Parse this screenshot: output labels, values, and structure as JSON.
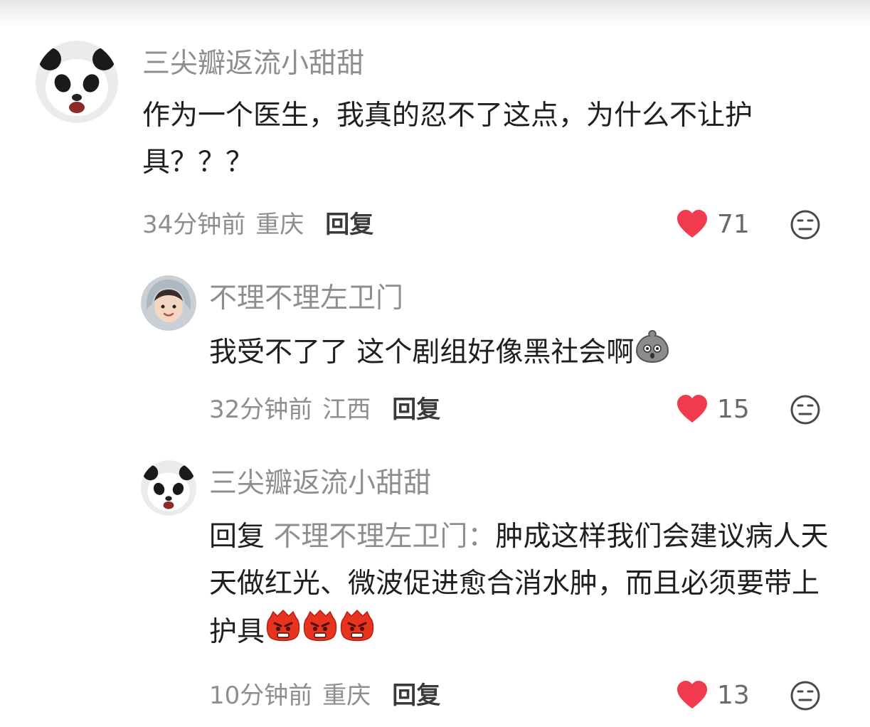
{
  "comments": [
    {
      "username": "三尖瓣返流小甜甜",
      "text": "作为一个医生，我真的忍不了这点，为什么不让护具？？？",
      "time": "34分钟前",
      "location": "重庆",
      "reply_label": "回复",
      "likes": "71"
    },
    {
      "username": "不理不理左卫门",
      "text": "我受不了了 这个剧组好像黑社会啊",
      "time": "32分钟前",
      "location": "江西",
      "reply_label": "回复",
      "likes": "15"
    },
    {
      "username": "三尖瓣返流小甜甜",
      "reply_prefix": "回复",
      "reply_target": "不理不理左卫门：",
      "text": "肿成这样我们会建议病人天天做红光、微波促进愈合消水肿，而且必须要带上护具",
      "time": "10分钟前",
      "location": "重庆",
      "reply_label": "回复",
      "likes": "13"
    }
  ],
  "icons": {
    "like": "heart-icon",
    "dislike": "dislike-face-icon",
    "emoji_scared": "scared-emoji",
    "emoji_angry": "angry-emoji"
  },
  "colors": {
    "like_red": "#f23a4e",
    "username_gray": "#8e8e8e"
  }
}
